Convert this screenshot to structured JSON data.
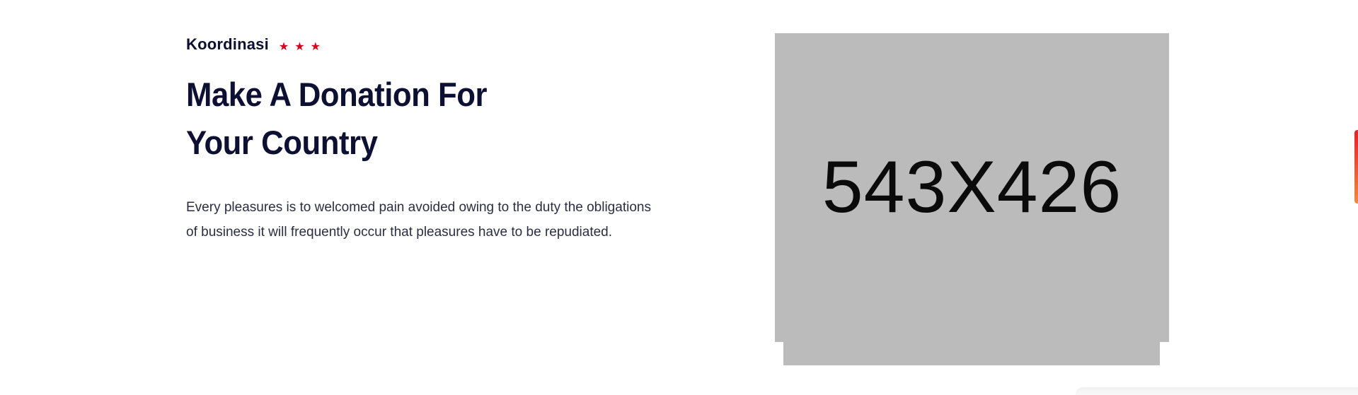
{
  "section": {
    "subtitle": "Koordinasi",
    "stars": [
      "★",
      "★",
      "★"
    ],
    "heading_lines": [
      "Make A Donation For",
      "Your Country"
    ],
    "description_lines": [
      "Every pleasures is to welcomed pain avoided owing to the duty the obligations",
      "of business it will frequently occur that pleasures have to be repudiated."
    ]
  },
  "image": {
    "placeholder_label": "543X426",
    "background_color": "#bbbbbb"
  },
  "colors": {
    "heading": "#0d1033",
    "accent_star": "#d9001b",
    "side_tab": "#e8202a"
  }
}
